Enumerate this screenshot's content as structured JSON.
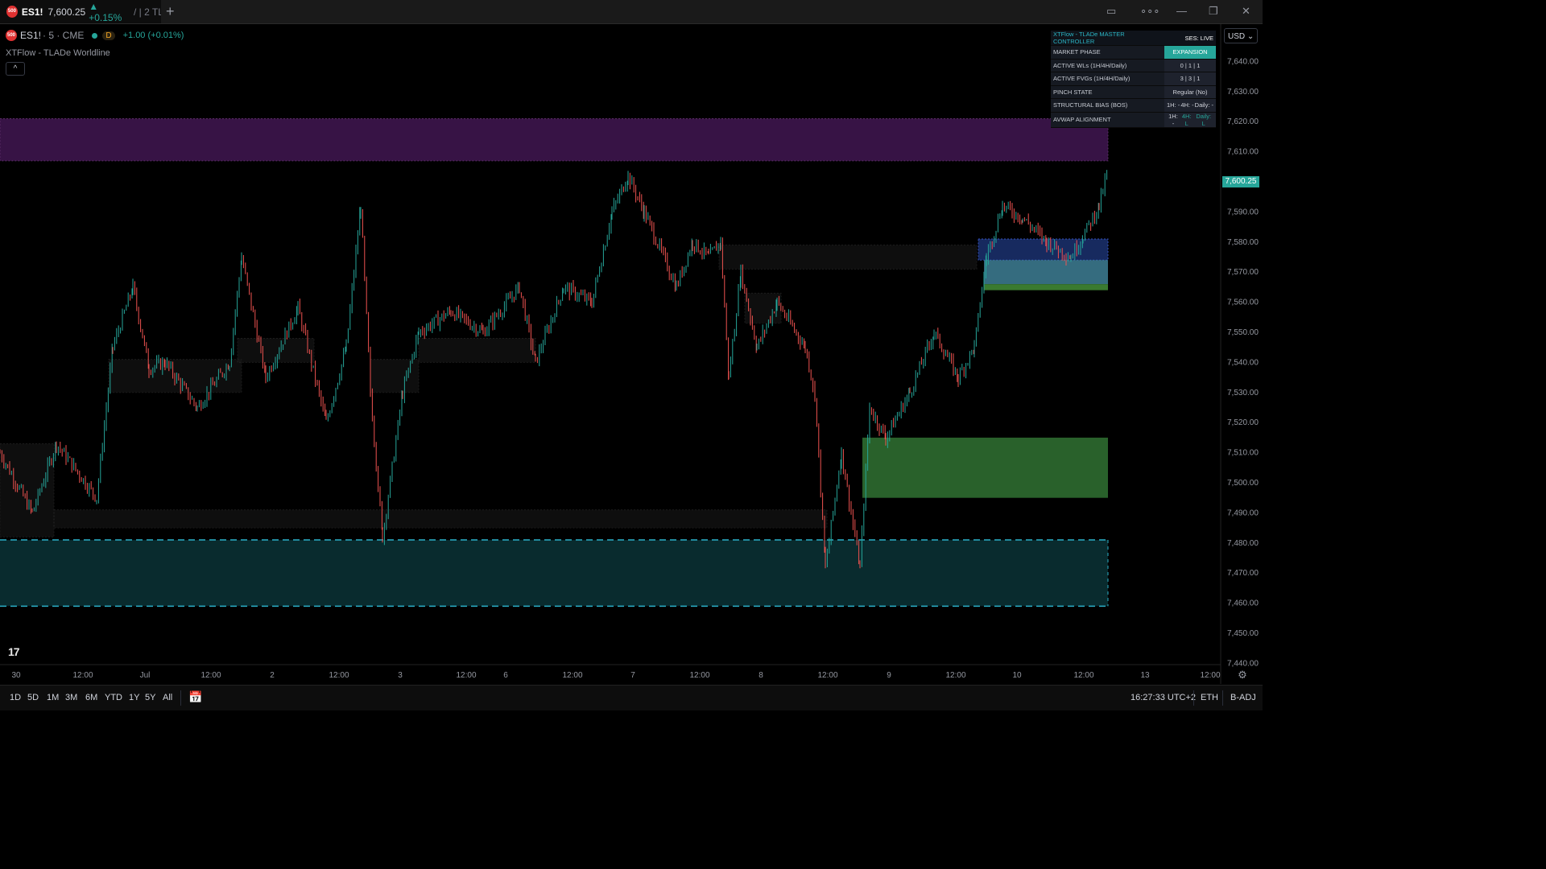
{
  "tab": {
    "symbol": "ES1!",
    "price": "7,600.25",
    "change": "▲ +0.15%",
    "extra": "/ | 2 TL",
    "badge": "500"
  },
  "legend": {
    "symbol": "ES1!",
    "details": "· 5 · CME",
    "d_badge": "D",
    "change": "+1.00 (+0.01%)",
    "indicator": "XTFlow - TLADe Worldline",
    "badge": "500"
  },
  "table": {
    "title": "XTFlow - TLADe MASTER CONTROLLER",
    "session": "SES: LIVE",
    "rows": {
      "phase": {
        "label": "MARKET PHASE",
        "value": "EXPANSION"
      },
      "wls": {
        "label": "ACTIVE WLs (1H/4H/Daily)",
        "value": "0 | 1 | 1"
      },
      "fvgs": {
        "label": "ACTIVE FVGs (1H/4H/Daily)",
        "value": "3 | 3 | 1"
      },
      "pinch": {
        "label": "PINCH STATE",
        "value": "Regular (No)"
      },
      "bias": {
        "label": "STRUCTURAL BIAS (BOS)",
        "v1": "1H: -",
        "v2": "4H: -",
        "v3": "Daily: -"
      },
      "avwap": {
        "label": "AVWAP ALIGNMENT",
        "v1": "1H: -",
        "v2": "4H: L",
        "v3": "Daily: L"
      }
    }
  },
  "currency": "USD",
  "last_price_label": "7,600.25",
  "price_axis": {
    "ticks": [
      "7,640.00",
      "7,630.00",
      "7,620.00",
      "7,610.00",
      "7,590.00",
      "7,580.00",
      "7,570.00",
      "7,560.00",
      "7,550.00",
      "7,540.00",
      "7,530.00",
      "7,520.00",
      "7,510.00",
      "7,500.00",
      "7,490.00",
      "7,480.00",
      "7,470.00",
      "7,460.00",
      "7,450.00",
      "7,440.00"
    ],
    "ymin": 7438,
    "ymax": 7650
  },
  "time_axis": {
    "labels": [
      "30",
      "12:00",
      "Jul",
      "12:00",
      "2",
      "12:00",
      "3",
      "12:00",
      "6",
      "12:00",
      "7",
      "12:00",
      "8",
      "12:00",
      "9",
      "12:00",
      "10",
      "12:00",
      "13",
      "12:00"
    ]
  },
  "bottom": {
    "ranges": [
      "1D",
      "5D",
      "1M",
      "3M",
      "6M",
      "YTD",
      "1Y",
      "5Y",
      "All"
    ],
    "clock": "16:27:33 UTC+2",
    "session": "ETH",
    "adj": "B-ADJ"
  },
  "colors": {
    "up": "#26a69a",
    "down": "#ef5350",
    "zone_purple": "#4a1a5c",
    "zone_teal": "#0b3236",
    "zone_green": "#2e6b30",
    "zone_blue": "#1a2f6a",
    "zone_lightblue": "#3e7f95"
  }
}
